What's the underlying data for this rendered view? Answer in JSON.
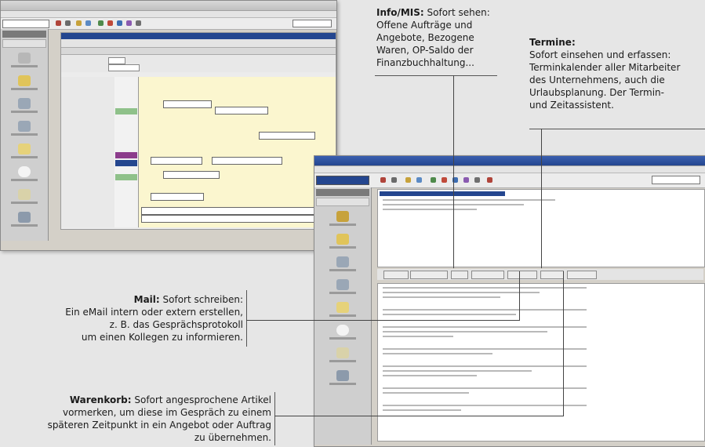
{
  "annotations": {
    "info": {
      "title": "Info/MIS:",
      "lines": [
        "Sofort sehen:",
        "Offene Aufträge und",
        "Angebote, Bezogene",
        "Waren, OP-Saldo der",
        "Finanzbuchhaltung..."
      ]
    },
    "termine": {
      "title": "Termine:",
      "lines": [
        "Sofort einsehen und erfassen:",
        "Terminkalender aller Mitarbeiter",
        "des Unternehmens, auch die",
        "Urlaubsplanung. Der Termin-",
        "und Zeitassistent."
      ]
    },
    "mail": {
      "title": "Mail:",
      "lines": [
        "Sofort schreiben:",
        "Ein eMail intern oder extern erstellen,",
        "z. B. das Gesprächsprotokoll",
        "um einen Kollegen zu informieren."
      ]
    },
    "warenkorb": {
      "title": "Warenkorb:",
      "lines": [
        "Sofort angesprochene Artikel",
        "vormerken, um diese im Gespräch zu einem",
        "späteren Zeitpunkt in ein Angebot oder Auftrag",
        "zu übernehmen."
      ]
    }
  },
  "colors": {
    "background": "#e6e6e6",
    "window": "#d4d0c8",
    "calendar": "#fbf6cf",
    "accent_blue": "#24468f",
    "accent_green": "#8fc18a",
    "accent_purple": "#8c3c8c"
  },
  "icons": [
    "gear-icon",
    "folder-icon",
    "calendar-icon",
    "mail-icon",
    "basket-icon",
    "person-icon"
  ]
}
